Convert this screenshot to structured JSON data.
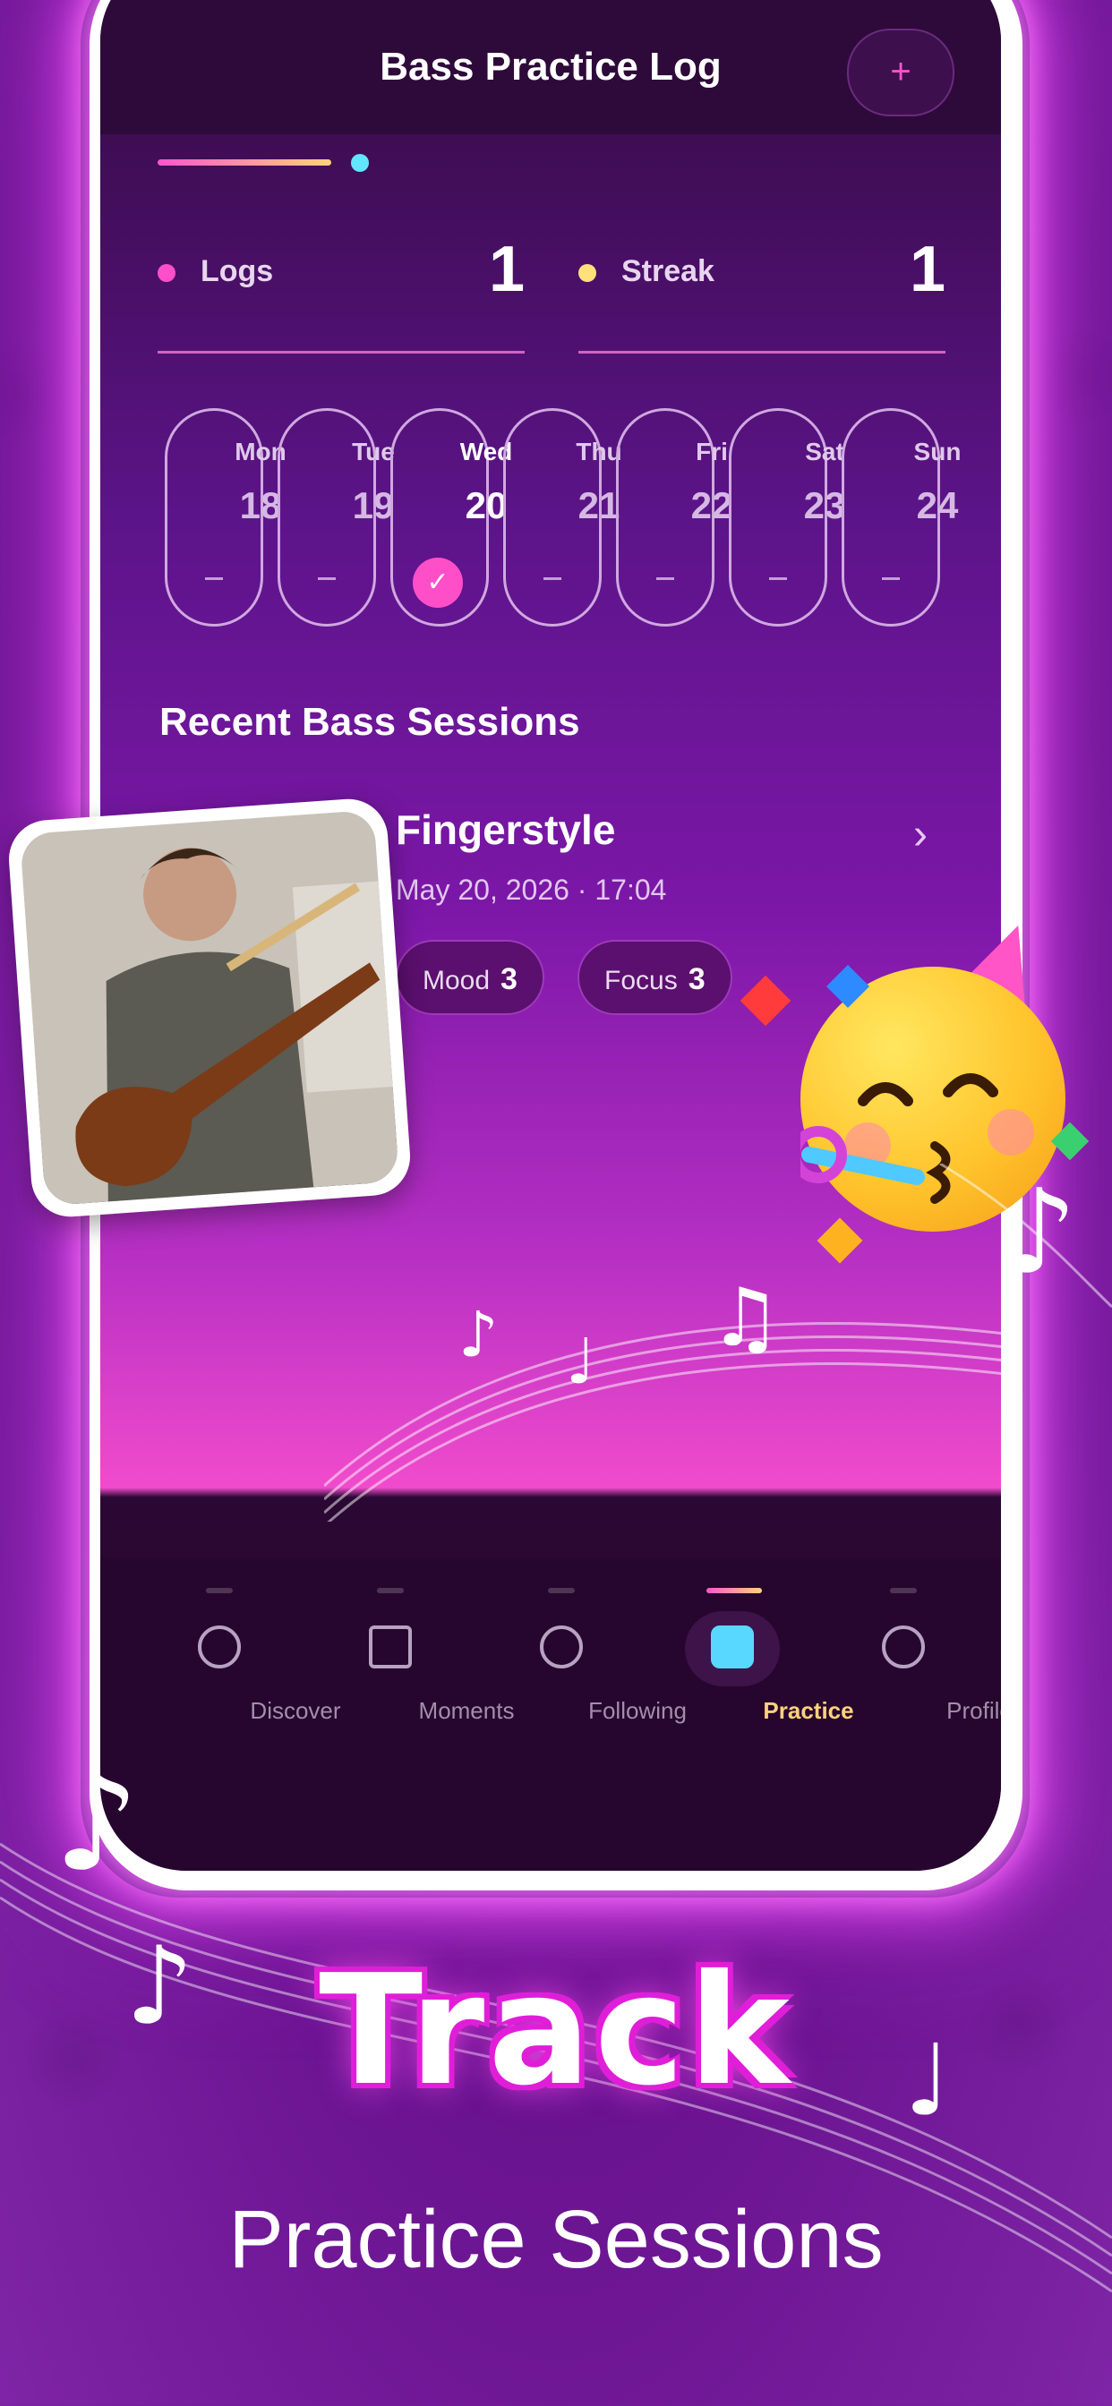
{
  "app": {
    "title": "Bass Practice Log",
    "add_label": "+"
  },
  "stats": [
    {
      "label": "Logs",
      "value": "1",
      "dot_color": "#ff4fc8"
    },
    {
      "label": "Streak",
      "value": "1",
      "dot_color": "#ffe07a"
    }
  ],
  "week": [
    {
      "name": "Mon",
      "date": "18",
      "mark": "–",
      "active": false
    },
    {
      "name": "Tue",
      "date": "19",
      "mark": "–",
      "active": false
    },
    {
      "name": "Wed",
      "date": "20",
      "mark": "✓",
      "active": true
    },
    {
      "name": "Thu",
      "date": "21",
      "mark": "–",
      "active": false
    },
    {
      "name": "Fri",
      "date": "22",
      "mark": "–",
      "active": false
    },
    {
      "name": "Sat",
      "date": "23",
      "mark": "–",
      "active": false
    },
    {
      "name": "Sun",
      "date": "24",
      "mark": "–",
      "active": false
    }
  ],
  "recent": {
    "heading": "Recent Bass Sessions",
    "session": {
      "title": "Fingerstyle",
      "datetime": "May 20, 2026 · 17:04",
      "tags": [
        {
          "label": "Mood",
          "value": "3"
        },
        {
          "label": "Focus",
          "value": "3"
        }
      ]
    }
  },
  "nav": [
    {
      "label": "Discover",
      "icon": "compass-icon",
      "active": false
    },
    {
      "label": "Moments",
      "icon": "clapperboard-icon",
      "active": false
    },
    {
      "label": "Following",
      "icon": "people-icon",
      "active": false
    },
    {
      "label": "Practice",
      "icon": "music-note-icon",
      "active": true
    },
    {
      "label": "Profile",
      "icon": "profile-icon",
      "active": false
    }
  ],
  "promo": {
    "headline": "Track",
    "subheadline": "Practice Sessions"
  },
  "colors": {
    "accent_pink": "#ff4fc8",
    "accent_yellow": "#ffd27a",
    "accent_cyan": "#59d8ff"
  }
}
